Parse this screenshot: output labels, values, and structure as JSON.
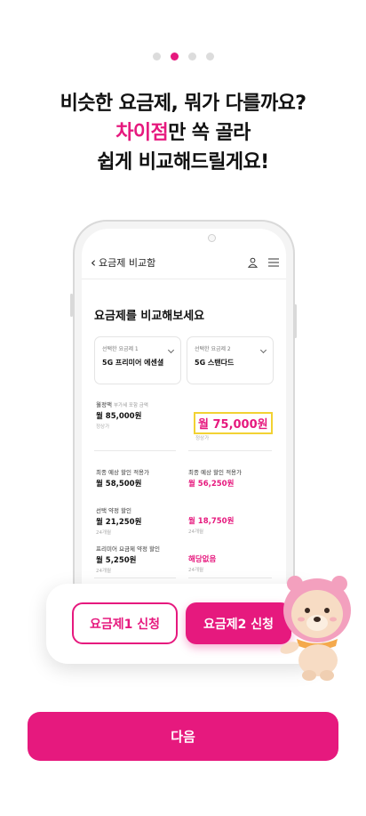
{
  "pagination": {
    "total": 4,
    "active": 1
  },
  "headline": {
    "line1": "비슷한 요금제, 뭐가 다를까요?",
    "line2_highlight": "차이점",
    "line2_rest": "만 쏙 골라",
    "line3": "쉽게 비교해드릴게요!"
  },
  "phone": {
    "header_title": "요금제 비교함",
    "section_title": "요금제를 비교해보세요",
    "plan1": {
      "caption": "선택한 요금제 1",
      "name": "5G 프리미어 에센셜"
    },
    "plan2": {
      "caption": "선택한 요금제 2",
      "name": "5G 스탠다드"
    },
    "monthly": {
      "label": "월정액",
      "sublabel": "부가세 포함 금액",
      "plan1_value": "월 85,000원",
      "plan1_note": "정상가",
      "plan2_value": "월 75,000원",
      "plan2_note": "정상가"
    },
    "final": {
      "label1": "최종 예상 할인 적용가",
      "value1": "월 58,500원",
      "label2": "최종 예상 할인 적용가",
      "value2": "월 56,250원"
    },
    "contract": {
      "label": "선택 약정 할인",
      "value1": "월 21,250원",
      "note1": "24개월",
      "value2": "월 18,750원",
      "note2": "24개월"
    },
    "premier": {
      "label": "프리미어 요금제 약정 할인",
      "value1": "월 5,250원",
      "note1": "24개월",
      "value2": "해당없음",
      "note2": "24개월"
    }
  },
  "buttons": {
    "apply1": "요금제1 신청",
    "apply2": "요금제2 신청",
    "next": "다음"
  },
  "colors": {
    "accent": "#e6197e",
    "highlight_border": "#f2d233"
  }
}
